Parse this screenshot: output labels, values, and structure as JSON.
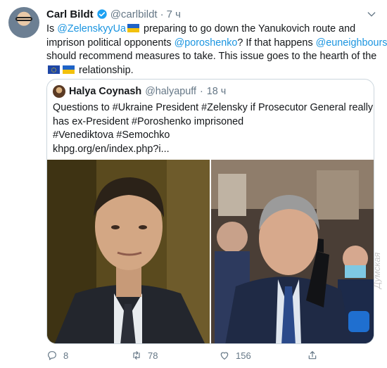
{
  "tweet": {
    "author_name": "Carl Bildt",
    "author_handle": "@carlbildt",
    "separator": "·",
    "time": "7 ч",
    "text_lines": [
      {
        "parts": [
          {
            "t": "Is ",
            "link": false
          },
          {
            "t": "@ZelenskyyUa",
            "link": true
          },
          {
            "flag": "ua"
          },
          {
            "t": " preparing to go down the Yanukovich route and",
            "link": false
          }
        ]
      },
      {
        "parts": [
          {
            "t": "imprison political opponents ",
            "link": false
          },
          {
            "t": "@poroshenko",
            "link": true
          },
          {
            "t": "? If that happens ",
            "link": false
          },
          {
            "t": "@euneighbours",
            "link": true
          }
        ]
      },
      {
        "parts": [
          {
            "t": "should recommend measures to take. This issue goes to the hearth of the",
            "link": false
          }
        ]
      },
      {
        "parts": [
          {
            "flag": "eu"
          },
          {
            "flag": "ua"
          },
          {
            "t": " relationship.",
            "link": false
          }
        ]
      }
    ]
  },
  "quote": {
    "author_name": "Halya Coynash",
    "author_handle": "@halyapuff",
    "separator": "·",
    "time": "18 ч",
    "text_lines": [
      "Questions to #Ukraine President #Zelensky if Prosecutor General really",
      "has ex-President #Poroshenko imprisoned",
      "#Venediktova #Semochko",
      "khpg.org/en/index.php?i..."
    ]
  },
  "actions": {
    "reply_count": "8",
    "retweet_count": "78",
    "like_count": "156"
  },
  "watermark": "Думская",
  "colors": {
    "link": "#1b95e0",
    "muted": "#657786",
    "border": "#ccd6dd",
    "verified": "#1da1f2"
  }
}
